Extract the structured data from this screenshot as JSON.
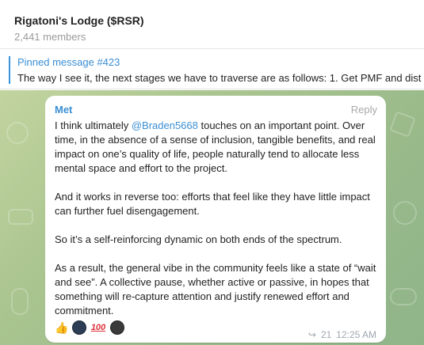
{
  "header": {
    "title": "Rigatoni's Lodge ($RSR)",
    "members": "2,441 members"
  },
  "pinned": {
    "title": "Pinned message #423",
    "text": "The way I see it, the next stages we have to traverse are as follows:  1. Get PMF and dist"
  },
  "message": {
    "author": "Met",
    "reply_label": "Reply",
    "p1_before": "I think ultimately ",
    "mention": "@Braden5668",
    "p1_after": "  touches on an important point. Over time, in the absence of a sense of inclusion, tangible benefits, and real impact on one’s quality of life, people naturally tend to allocate less mental space and effort to the project.",
    "p2": "And it works in reverse too: efforts that feel like they have little impact can further fuel disengagement.",
    "p3": "So it’s a self-reinforcing dynamic on both ends of the spectrum.",
    "p4": "As a result, the general vibe in the community feels like a state of “wait and see”. A collective pause, whether active or passive, in hopes that something will re-capture attention and justify renewed effort and commitment.",
    "reactions": [
      {
        "icon": "thumbs-up-icon",
        "glyph": "👍"
      },
      {
        "icon": "avatar-icon",
        "glyph": ""
      },
      {
        "icon": "hundred-points-icon",
        "glyph": "100"
      },
      {
        "icon": "avatar-icon",
        "glyph": ""
      }
    ],
    "views": "21",
    "time": "12:25 AM"
  },
  "colors": {
    "accent": "#3a8ed4",
    "chat_background": "#a9c48f"
  }
}
